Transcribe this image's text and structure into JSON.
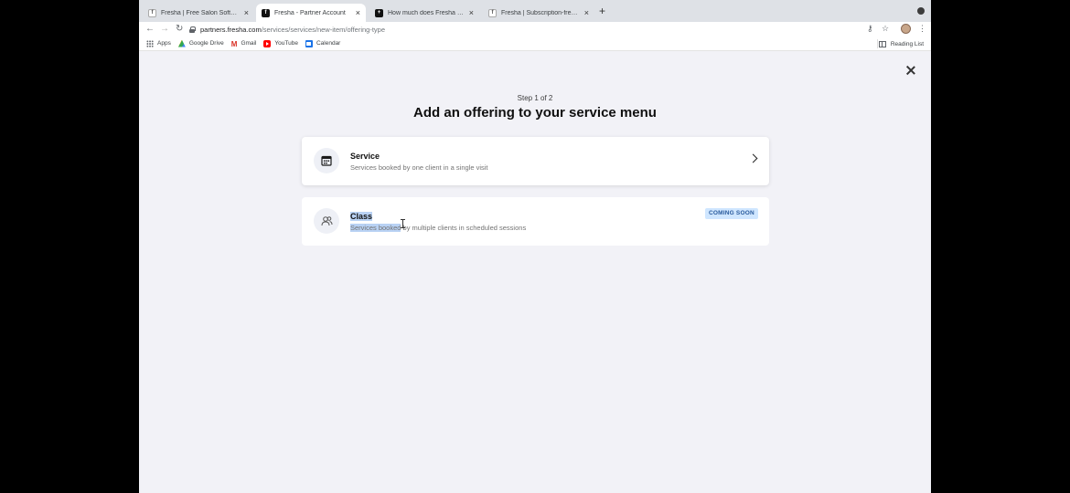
{
  "browser": {
    "tabs": [
      {
        "title": "Fresha | Free Salon Software |",
        "favicon": "fresha-logo-light",
        "active": false
      },
      {
        "title": "Fresha - Partner Account",
        "favicon": "fresha-logo-dark",
        "active": true
      },
      {
        "title": "How much does Fresha Plus co",
        "favicon": "plus-square-icon",
        "active": false
      },
      {
        "title": "Fresha | Subscription-free Salo",
        "favicon": "fresha-logo-light",
        "active": false
      }
    ],
    "new_tab_label": "+",
    "close_label": "×",
    "url_host": "partners.fresha.com",
    "url_path": "/services/services/new-item/offering-type",
    "bookmarks": [
      {
        "label": "Apps",
        "icon": "apps-grid-icon"
      },
      {
        "label": "Google Drive",
        "icon": "google-drive-icon"
      },
      {
        "label": "Gmail",
        "icon": "gmail-icon"
      },
      {
        "label": "YouTube",
        "icon": "youtube-icon"
      },
      {
        "label": "Calendar",
        "icon": "calendar-icon"
      }
    ],
    "reading_list": "Reading List"
  },
  "page": {
    "step": "Step 1 of 2",
    "title": "Add an offering to your service menu",
    "options": [
      {
        "name": "Service",
        "description": "Services booked by one client in a single visit",
        "icon": "calendar-icon",
        "action": "chevron-right-icon"
      },
      {
        "name": "Class",
        "description_selected": "Services booked",
        "description_rest": " by multiple clients in scheduled sessions",
        "icon": "group-icon",
        "badge": "COMING SOON"
      }
    ]
  },
  "colors": {
    "page_bg": "#f2f2f7",
    "badge_bg": "#cfe6ff",
    "selection": "#b9d2f4"
  }
}
